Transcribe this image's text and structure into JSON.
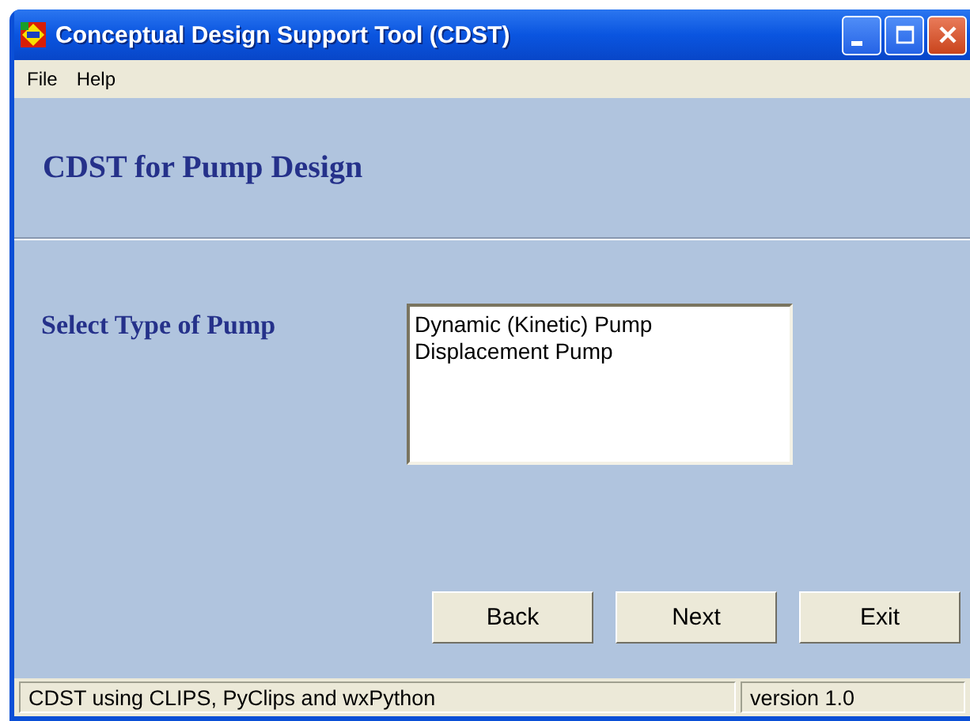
{
  "window": {
    "title": "Conceptual Design Support Tool (CDST)"
  },
  "menu": [
    "File",
    "Help"
  ],
  "header": {
    "title": "CDST for Pump Design"
  },
  "form": {
    "label": "Select Type of Pump",
    "options": [
      {
        "label": "Dynamic (Kinetic) Pump",
        "selected": false
      },
      {
        "label": "Displacement Pump",
        "selected": false
      }
    ]
  },
  "buttons": [
    "Back",
    "Next",
    "Exit"
  ],
  "status_bar": [
    "CDST using CLIPS, PyClips and wxPython",
    "version 1.0"
  ]
}
